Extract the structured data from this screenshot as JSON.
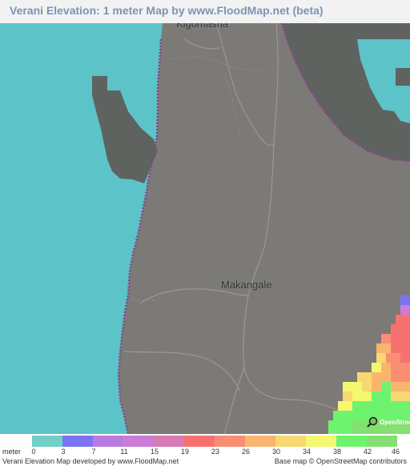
{
  "header": {
    "title": "Verani Elevation: 1 meter Map by www.FloodMap.net (beta)"
  },
  "map": {
    "places": [
      {
        "name": "Kigomasha"
      },
      {
        "name": "Makangale"
      }
    ],
    "colors": {
      "sea": "#5cc3c8",
      "land": "#7c7a77",
      "dark_land": "#5e6360",
      "road": "#9a9894",
      "coast_dots": "#8a3f8a"
    },
    "osm_badge": "OpenStreetMap"
  },
  "legend": {
    "unit": "meter",
    "ticks": [
      "0",
      "3",
      "7",
      "11",
      "15",
      "19",
      "23",
      "26",
      "30",
      "34",
      "38",
      "42",
      "46"
    ],
    "colors": [
      "#71cfc9",
      "#7b74f2",
      "#b97be0",
      "#cd7bd9",
      "#d779b2",
      "#f87171",
      "#f98e72",
      "#f9b56e",
      "#f8d96f",
      "#f4f76f",
      "#6ef36f",
      "#83e071"
    ]
  },
  "footer": {
    "left": "Verani Elevation Map developed by www.FloodMap.net",
    "right": "Base map © OpenStreetMap contributors"
  }
}
